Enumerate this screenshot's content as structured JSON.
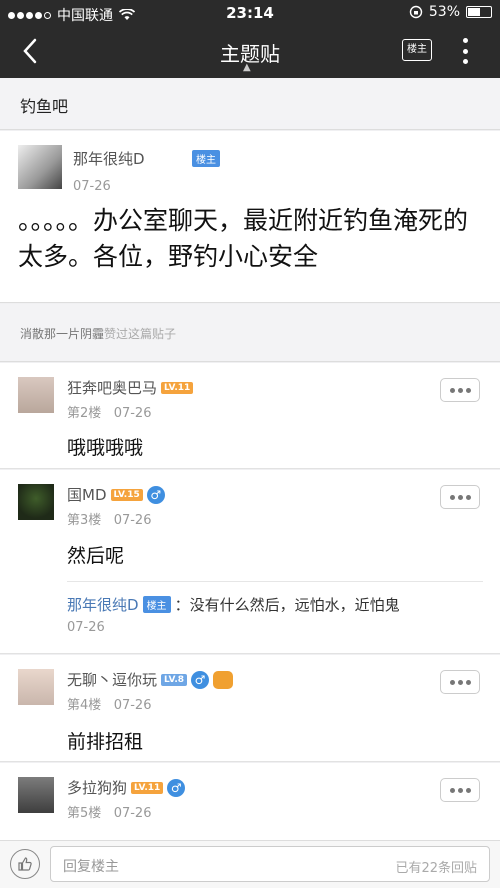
{
  "status_bar": {
    "carrier": "中国联通",
    "time": "23:14",
    "battery_percent": "53%",
    "battery_level": 0.53
  },
  "nav": {
    "title": "主题贴",
    "louzhu_button": "楼主"
  },
  "forum": {
    "name": "钓鱼吧"
  },
  "original_post": {
    "username": "那年很纯D",
    "badge": "楼主",
    "date": "07-26",
    "content": "。。。。。办公室聊天，最近附近钓鱼淹死的太多。各位，野钓小心安全"
  },
  "likes": {
    "user": "消散那一片阴霾",
    "suffix": "赞过这篇贴子"
  },
  "floors": [
    {
      "username": "狂奔吧奥巴马",
      "level": "LV.11",
      "floor": "第2楼",
      "date": "07-26",
      "content": "哦哦哦哦"
    },
    {
      "username": "国MD",
      "level": "LV.15",
      "floor": "第3楼",
      "date": "07-26",
      "content": "然后呢",
      "sub_reply": {
        "username": "那年很纯D",
        "badge": "楼主",
        "text": "：没有什么然后，远怕水，近怕鬼",
        "date": "07-26"
      }
    },
    {
      "username": "无聊丶逗你玩",
      "level": "LV.8",
      "floor": "第4楼",
      "date": "07-26",
      "content": "前排招租"
    },
    {
      "username": "多拉狗狗",
      "level": "LV.11",
      "floor": "第5楼",
      "date": "07-26"
    }
  ],
  "reply_bar": {
    "placeholder": "回复楼主",
    "count_text": "已有22条回贴"
  },
  "colors": {
    "nav_bg": "#2b2b2b",
    "louzhu_badge": "#4a90e2",
    "level_orange": "#f5a33d",
    "level_blue": "#6ea6e5",
    "link_blue": "#4a79b5"
  }
}
